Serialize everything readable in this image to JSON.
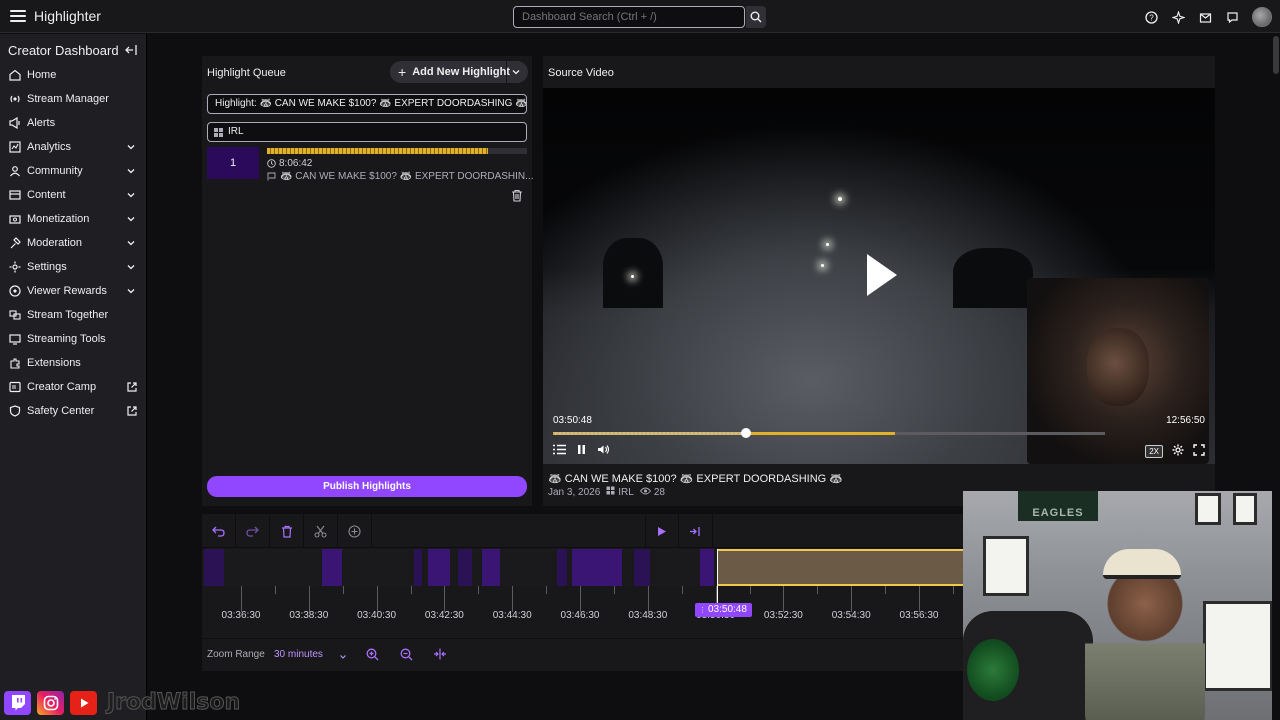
{
  "app": {
    "title": "Highlighter"
  },
  "search": {
    "placeholder": "Dashboard Search (Ctrl + /)"
  },
  "topbar_icons": [
    "help-icon",
    "sparkle-icon",
    "inbox-icon",
    "whispers-icon",
    "avatar"
  ],
  "sidebar": {
    "header": "Creator Dashboard",
    "items": [
      {
        "label": "Home",
        "icon": "home-icon",
        "has_chevron": false,
        "external": false
      },
      {
        "label": "Stream Manager",
        "icon": "stream-manager-icon",
        "has_chevron": false,
        "external": false
      },
      {
        "label": "Alerts",
        "icon": "alerts-icon",
        "has_chevron": false,
        "external": false
      },
      {
        "label": "Analytics",
        "icon": "analytics-icon",
        "has_chevron": true,
        "external": false
      },
      {
        "label": "Community",
        "icon": "community-icon",
        "has_chevron": true,
        "external": false
      },
      {
        "label": "Content",
        "icon": "content-icon",
        "has_chevron": true,
        "external": false
      },
      {
        "label": "Monetization",
        "icon": "monetization-icon",
        "has_chevron": true,
        "external": false
      },
      {
        "label": "Moderation",
        "icon": "moderation-icon",
        "has_chevron": true,
        "external": false
      },
      {
        "label": "Settings",
        "icon": "settings-icon",
        "has_chevron": true,
        "external": false
      },
      {
        "label": "Viewer Rewards",
        "icon": "viewer-rewards-icon",
        "has_chevron": true,
        "external": false
      },
      {
        "label": "Stream Together",
        "icon": "stream-together-icon",
        "has_chevron": false,
        "external": false
      },
      {
        "label": "Streaming Tools",
        "icon": "streaming-tools-icon",
        "has_chevron": false,
        "external": false
      },
      {
        "label": "Extensions",
        "icon": "extensions-icon",
        "has_chevron": false,
        "external": false
      },
      {
        "label": "Creator Camp",
        "icon": "creator-camp-icon",
        "has_chevron": false,
        "external": true
      },
      {
        "label": "Safety Center",
        "icon": "safety-center-icon",
        "has_chevron": false,
        "external": true
      }
    ]
  },
  "queue": {
    "title": "Highlight Queue",
    "add_button": "Add New Highlight",
    "highlight_title": "Highlight: 🦝 CAN WE MAKE $100? 🦝 EXPERT DOORDASHING 🦝",
    "category": "IRL",
    "clip": {
      "number": "1",
      "duration": "8:06:42",
      "name": "🦝 CAN WE MAKE $100? 🦝 EXPERT DOORDASHIN...",
      "fill_fraction": 0.85
    },
    "publish_button": "Publish Highlights"
  },
  "source": {
    "title": "Source Video",
    "current_time": "03:50:48",
    "end_time": "12:56:50",
    "progress_fraction": 0.35,
    "speed": "2X",
    "video_title": "🦝 CAN WE MAKE $100? 🦝 EXPERT DOORDASHING 🦝",
    "date": "Jan 3, 2026",
    "category": "IRL",
    "views": "28"
  },
  "timeline": {
    "ticks": [
      "03:36:30",
      "03:38:30",
      "03:40:30",
      "03:42:30",
      "03:44:30",
      "03:46:30",
      "03:48:30",
      "03:50:30",
      "03:52:30",
      "03:54:30",
      "03:56:30"
    ],
    "cursor_time": "03:50:48"
  },
  "zoom": {
    "label": "Zoom Range",
    "value": "30 minutes"
  },
  "social": {
    "handle": "JrodWilson"
  },
  "colors": {
    "accent": "#9147ff",
    "highlight_gold": "#e1b12c",
    "background": "#0e0e10",
    "panel": "#18181b"
  }
}
